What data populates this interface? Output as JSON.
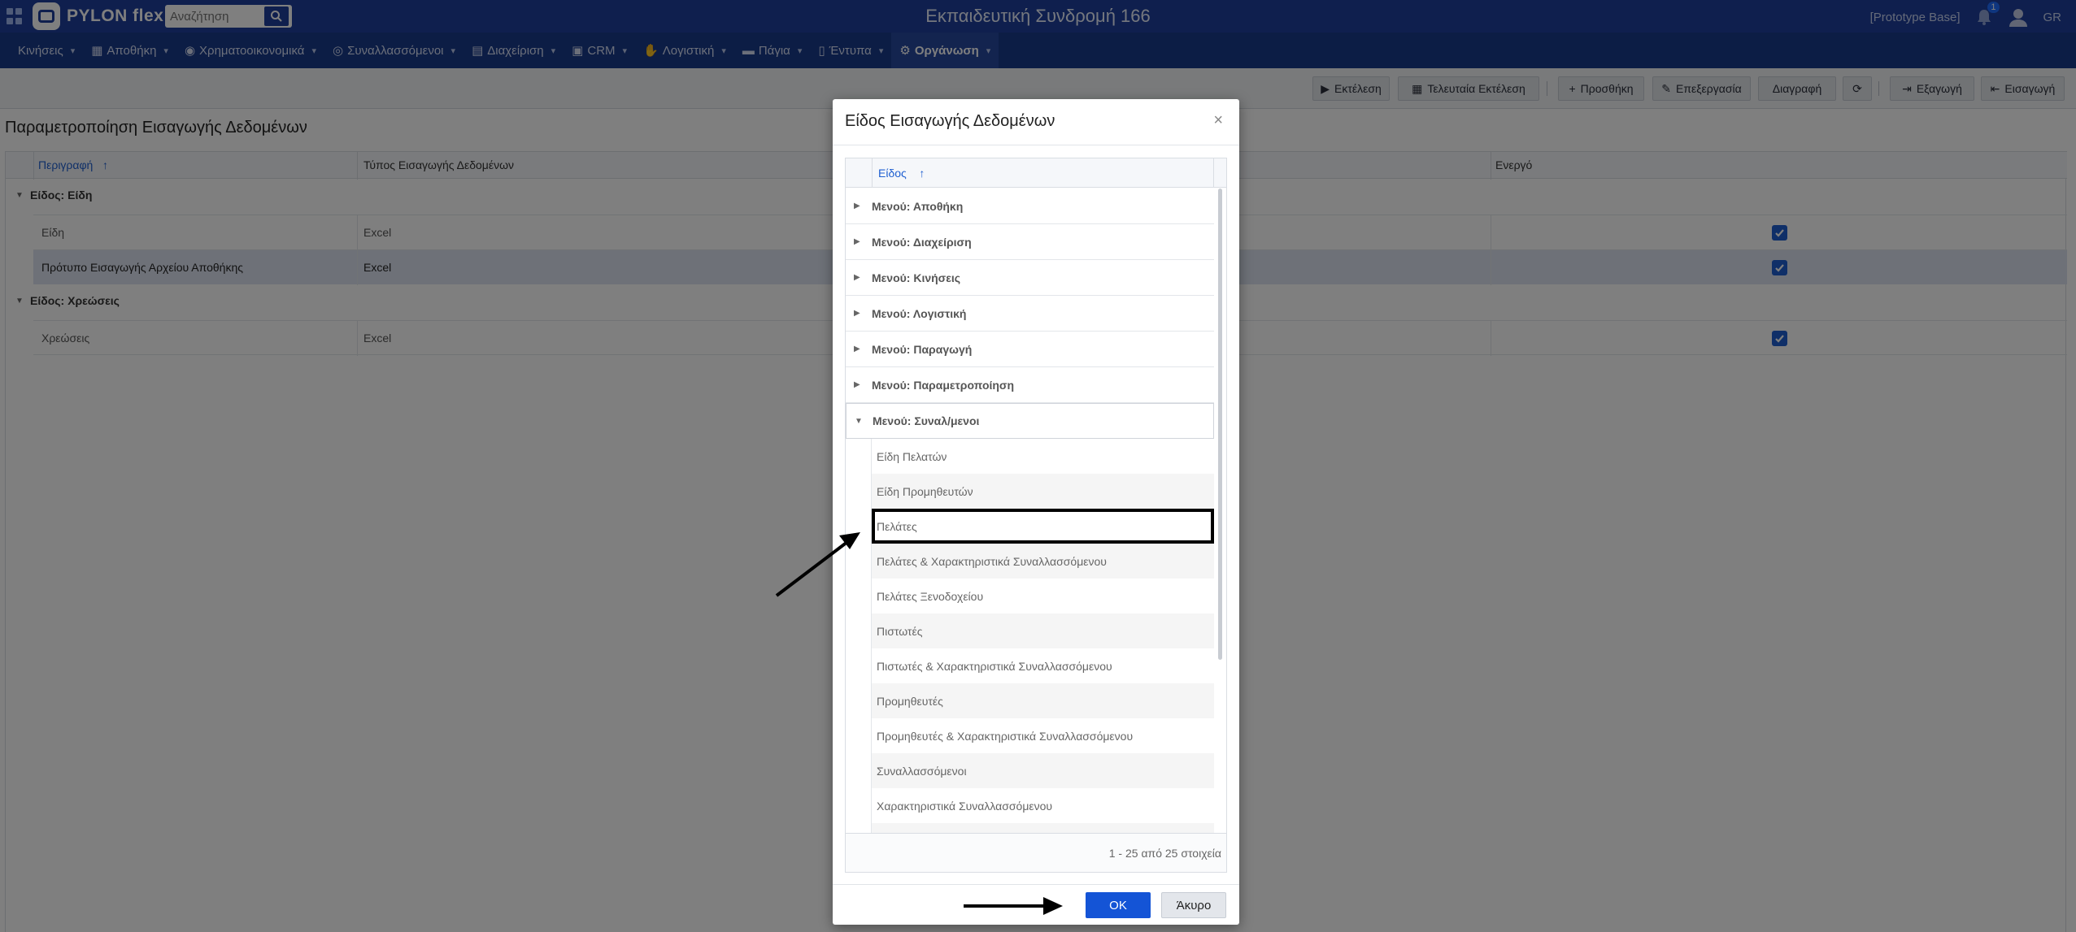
{
  "topbar": {
    "logo_text": "PYLON flex",
    "search_placeholder": "Αναζήτηση",
    "app_title": "Εκπαιδευτική Συνδρομή 166",
    "base_label": "[Prototype Base]",
    "notification_count": "1",
    "language": "GR"
  },
  "menu": {
    "items": [
      {
        "label": "Κινήσεις",
        "icon": "none"
      },
      {
        "label": "Αποθήκη",
        "icon": "warehouse-icon"
      },
      {
        "label": "Χρηματοοικονομικά",
        "icon": "coins-icon"
      },
      {
        "label": "Συναλλασσόμενοι",
        "icon": "binoculars-icon"
      },
      {
        "label": "Διαχείριση",
        "icon": "book-icon"
      },
      {
        "label": "CRM",
        "icon": "crm-icon"
      },
      {
        "label": "Λογιστική",
        "icon": "handshake-icon"
      },
      {
        "label": "Πάγια",
        "icon": "truck-icon"
      },
      {
        "label": "Έντυπα",
        "icon": "document-icon"
      },
      {
        "label": "Οργάνωση",
        "icon": "gear-icon"
      }
    ]
  },
  "toolbar": {
    "run": "Εκτέλεση",
    "last_run": "Τελευταία Εκτέλεση",
    "add": "Προσθήκη",
    "edit": "Επεξεργασία",
    "delete": "Διαγραφή",
    "export": "Εξαγωγή",
    "import": "Εισαγωγή"
  },
  "page": {
    "title": "Παραμετροποίηση Εισαγωγής Δεδομένων",
    "columns": [
      "Περιγραφή",
      "Τύπος Εισαγωγής Δεδομένων",
      "Ενεργό"
    ],
    "groups": [
      {
        "label": "Είδος: Είδη",
        "rows": [
          {
            "description": "Είδη",
            "type": "Excel",
            "active": true
          },
          {
            "description": "Πρότυπο Εισαγωγής Αρχείου Αποθήκης",
            "type": "Excel",
            "active": true
          }
        ]
      },
      {
        "label": "Είδος: Χρεώσεις",
        "rows": [
          {
            "description": "Χρεώσεις",
            "type": "Excel",
            "active": true
          }
        ]
      }
    ]
  },
  "modal": {
    "title": "Είδος Εισαγωγής Δεδομένων",
    "column_header": "Είδος",
    "groups": [
      "Μενού: Αποθήκη",
      "Μενού: Διαχείριση",
      "Μενού: Κινήσεις",
      "Μενού: Λογιστική",
      "Μενού: Παραγωγή",
      "Μενού: Παραμετροποίηση",
      "Μενού: Συναλ/μενοι"
    ],
    "items": [
      "Είδη Πελατών",
      "Είδη Προμηθευτών",
      "Πελάτες",
      "Πελάτες & Χαρακτηριστικά Συναλλασσόμενου",
      "Πελάτες Ξενοδοχείου",
      "Πιστωτές",
      "Πιστωτές & Χαρακτηριστικά Συναλλασσόμενου",
      "Προμηθευτές",
      "Προμηθευτές & Χαρακτηριστικά Συναλλασσόμενου",
      "Συναλλασσόμενοι",
      "Χαρακτηριστικά Συναλλασσόμενου"
    ],
    "selected_item": "Πελάτες",
    "pager": "1 - 25 από 25 στοιχεία",
    "ok": "OK",
    "cancel": "Άκυρο"
  },
  "colors": {
    "topbar": "#1f3f9c",
    "menubar": "#183a8a",
    "accent": "#1454d6",
    "checkbox": "#1f5fd0"
  }
}
